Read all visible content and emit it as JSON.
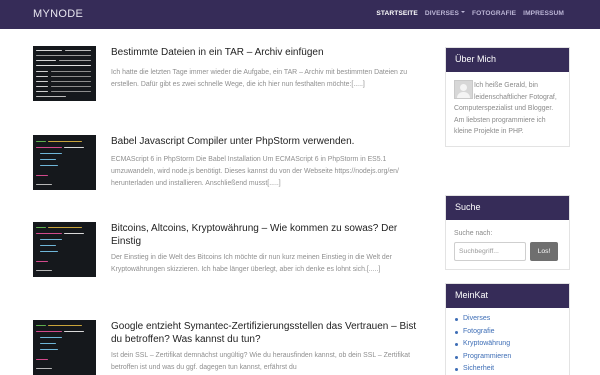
{
  "brand": "MYNODE",
  "nav": [
    {
      "label": "STARTSEITE",
      "active": true
    },
    {
      "label": "DIVERSES",
      "dropdown": true
    },
    {
      "label": "FOTOGRAFIE"
    },
    {
      "label": "IMPRESSUM"
    }
  ],
  "posts": [
    {
      "title": "Bestimmte Dateien in ein TAR – Archiv einfügen",
      "excerpt": "Ich hatte die letzten Tage immer wieder die Aufgabe, ein TAR – Archiv mit bestimmten Dateien zu erstellen. Dafür gibt es zwei schnelle Wege, die ich hier nun festhalten möchte:[.....]"
    },
    {
      "title": "Babel Javascript Compiler unter PhpStorm verwenden.",
      "excerpt": "ECMAScript 6 in PhpStorm Die Babel Installation Um ECMAScript 6 in PhpStorm in ES5.1 umzuwandeln, wird node.js benötigt. Dieses kannst du von der Webseite https://nodejs.org/en/ herunterladen und installieren. Anschließend musst[.....]"
    },
    {
      "title": "Bitcoins, Altcoins, Kryptowährung – Wie kommen zu sowas? Der Einstig",
      "excerpt": "Der Einstieg in die Welt des Bitcoins Ich möchte dir nun kurz meinen Einstieg in die Welt der Kryptowährungen skizzieren.  Ich habe länger überlegt, aber ich denke es lohnt sich.[.....]"
    },
    {
      "title": "Google entzieht Symantec-Zertifizierungsstellen das Vertrauen – Bist du betroffen? Was kannst du tun?",
      "excerpt": "Ist dein SSL – Zertifikat demnächst ungültig? Wie du herausfinden kannst, ob dein SSL – Zertifikat betroffen ist und was du ggf. dagegen tun kannst, erfährst du"
    }
  ],
  "sidebar": {
    "about": {
      "title": "Über Mich",
      "text": "Ich heiße Gerald, bin leidenschaftlicher Fotograf, Computerspezialist und Blogger. Am liebsten programmiere ich kleine Projekte in PHP."
    },
    "search": {
      "title": "Suche",
      "label": "Suche nach:",
      "placeholder": "Suchbegriff...",
      "button": "Los!"
    },
    "categories": {
      "title": "MeinKat",
      "items": [
        "Diverses",
        "Fotografie",
        "Kryptowährung",
        "Programmieren",
        "Sicherheit"
      ]
    }
  }
}
